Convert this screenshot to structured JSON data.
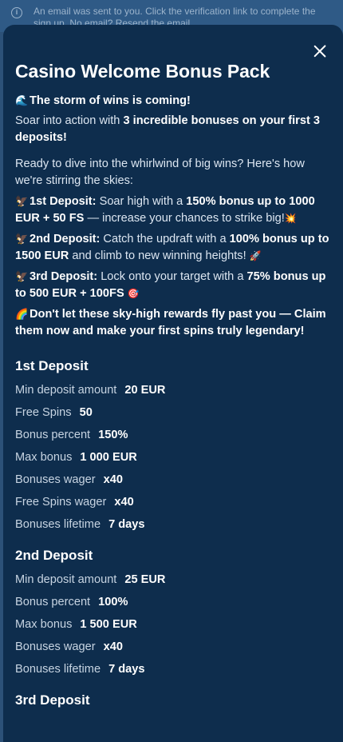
{
  "notice": {
    "icon": "info-icon",
    "text": "An email was sent to you. Click the verification link to complete the sign up. No email? Resend the email"
  },
  "modal": {
    "title": "Casino Welcome Bonus Pack",
    "intro": {
      "emoji1": "🌊",
      "tagline": "The storm of wins is coming!",
      "lead_a": "Soar into action with ",
      "lead_b": "3 incredible bonuses on your first 3 deposits!",
      "dive": "Ready to dive into the whirlwind of big wins? Here's how we're stirring the skies:",
      "d1_emoji": "🦅",
      "d1_label": "1st Deposit:",
      "d1_a": " Soar high with a ",
      "d1_b": "150% bonus up to 1000 EUR + 50 FS",
      "d1_c": " — increase your chances to strike big!",
      "d1_emoji_end": "💥",
      "d2_emoji": "🦅",
      "d2_label": "2nd Deposit:",
      "d2_a": " Catch the updraft with a ",
      "d2_b": "100% bonus up to 1500 EUR",
      "d2_c": " and climb to new winning heights!",
      "d2_emoji_end": "🚀",
      "d3_emoji": "🦅",
      "d3_label": "3rd Deposit:",
      "d3_a": " Lock onto your target with a ",
      "d3_b": "75% bonus up to 500 EUR + 100FS",
      "d3_emoji_end": "🎯",
      "claim_emoji": "🌈",
      "claim": "Don't let these sky-high rewards fly past you — Claim them now and make your first spins truly legendary!"
    },
    "deposits": [
      {
        "title": "1st Deposit",
        "rows": [
          {
            "label": "Min deposit amount",
            "value": "20 EUR"
          },
          {
            "label": "Free Spins",
            "value": "50"
          },
          {
            "label": "Bonus percent",
            "value": "150%"
          },
          {
            "label": "Max bonus",
            "value": "1 000 EUR"
          },
          {
            "label": "Bonuses wager",
            "value": "x40"
          },
          {
            "label": "Free Spins wager",
            "value": "x40"
          },
          {
            "label": "Bonuses lifetime",
            "value": "7 days"
          }
        ]
      },
      {
        "title": "2nd Deposit",
        "rows": [
          {
            "label": "Min deposit amount",
            "value": "25 EUR"
          },
          {
            "label": "Bonus percent",
            "value": "100%"
          },
          {
            "label": "Max bonus",
            "value": "1 500 EUR"
          },
          {
            "label": "Bonuses wager",
            "value": "x40"
          },
          {
            "label": "Bonuses lifetime",
            "value": "7 days"
          }
        ]
      },
      {
        "title": "3rd Deposit",
        "rows": []
      }
    ]
  }
}
